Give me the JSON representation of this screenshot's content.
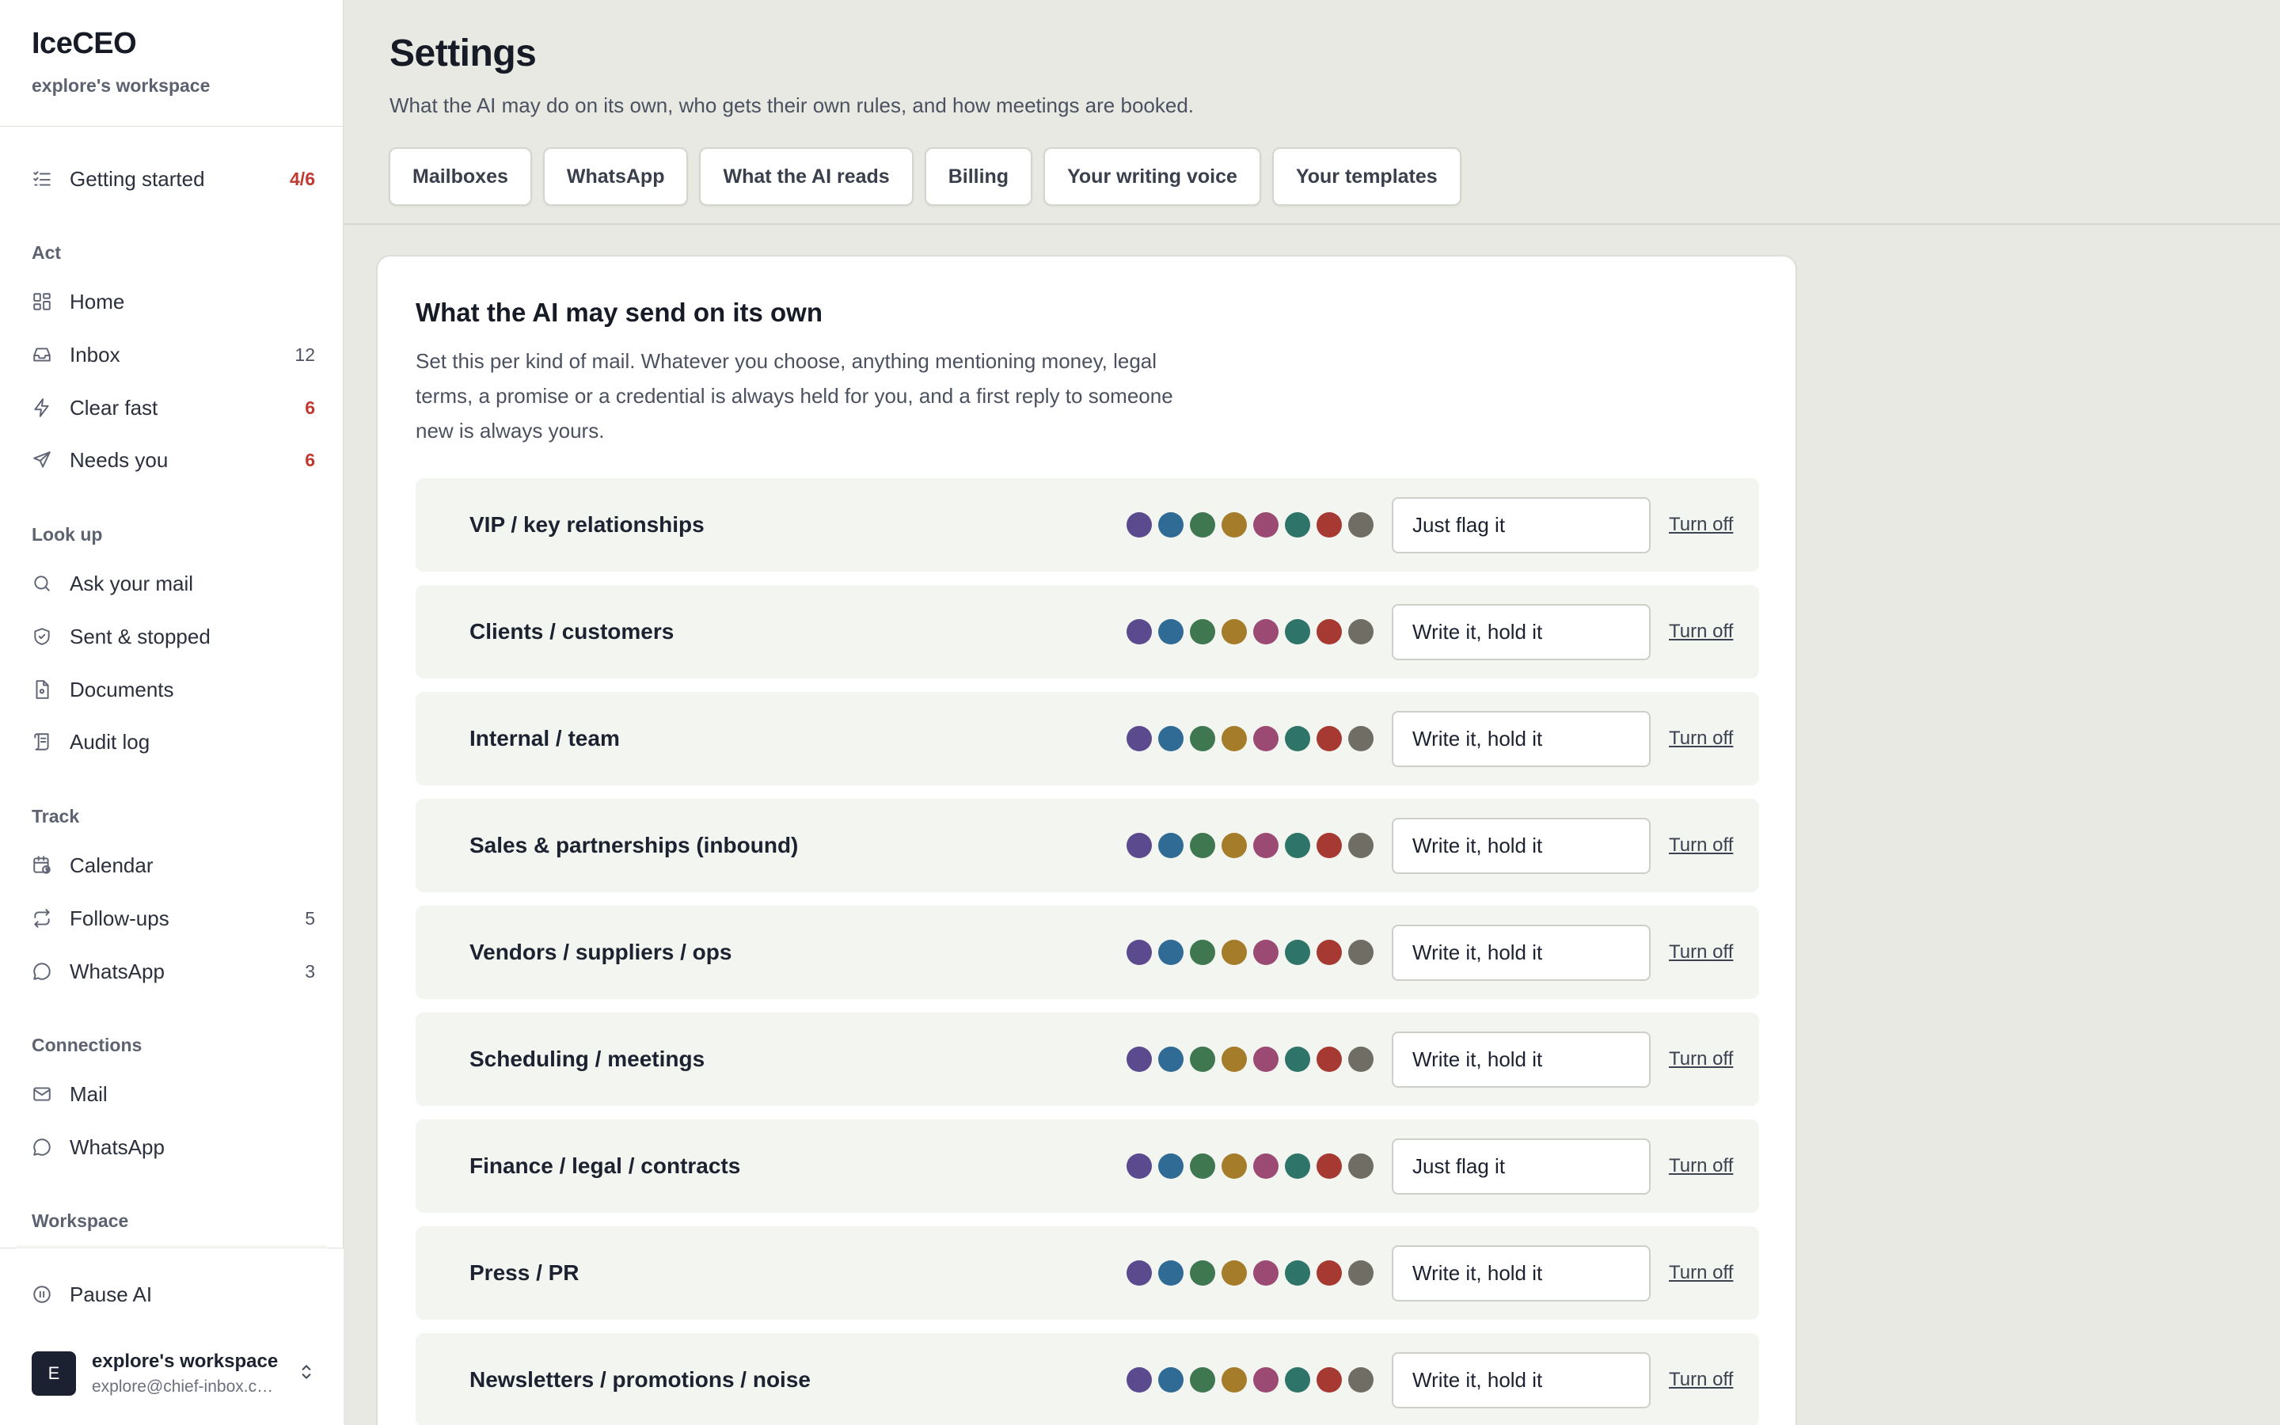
{
  "brand": {
    "name": "IceCEO",
    "workspace": "explore's workspace"
  },
  "sidebar": {
    "getting_started": {
      "label": "Getting started",
      "count": "4/6"
    },
    "sections": {
      "act": "Act",
      "lookup": "Look up",
      "track": "Track",
      "connections": "Connections",
      "workspace": "Workspace"
    },
    "act": [
      {
        "label": "Home",
        "count": "",
        "icon": "dashboard-icon"
      },
      {
        "label": "Inbox",
        "count": "12",
        "icon": "inbox-icon"
      },
      {
        "label": "Clear fast",
        "count": "6",
        "icon": "lightning-icon"
      },
      {
        "label": "Needs you",
        "count": "6",
        "icon": "send-icon"
      }
    ],
    "lookup": [
      {
        "label": "Ask your mail",
        "icon": "search-icon"
      },
      {
        "label": "Sent & stopped",
        "icon": "shield-icon"
      },
      {
        "label": "Documents",
        "icon": "document-icon"
      },
      {
        "label": "Audit log",
        "icon": "scroll-icon"
      }
    ],
    "track": [
      {
        "label": "Calendar",
        "count": "",
        "icon": "calendar-clock-icon"
      },
      {
        "label": "Follow-ups",
        "count": "5",
        "icon": "repeat-icon"
      },
      {
        "label": "WhatsApp",
        "count": "3",
        "icon": "chat-bubble-icon"
      }
    ],
    "connections": [
      {
        "label": "Mail",
        "icon": "mail-icon"
      },
      {
        "label": "WhatsApp",
        "icon": "chat-bubble-icon"
      }
    ],
    "pause": {
      "label": "Pause AI",
      "icon": "pause-icon"
    },
    "account": {
      "initial": "E",
      "name": "explore's workspace",
      "email": "explore@chief-inbox.com"
    }
  },
  "page": {
    "title": "Settings",
    "subtitle": "What the AI may do on its own, who gets their own rules, and how meetings are booked.",
    "tabs": [
      "Mailboxes",
      "WhatsApp",
      "What the AI reads",
      "Billing",
      "Your writing voice",
      "Your templates"
    ]
  },
  "card": {
    "title": "What the AI may send on its own",
    "description": "Set this per kind of mail. Whatever you choose, anything mentioning money, legal terms, a promise or a credential is always held for you, and a first reply to someone new is always yours.",
    "dot_colors": [
      "#5b4a8e",
      "#2f6b94",
      "#3f7750",
      "#a47c2a",
      "#9a4a73",
      "#2f7468",
      "#a63a33",
      "#6f6d64"
    ],
    "turn_off_label": "Turn off",
    "rows": [
      {
        "label": "VIP / key relationships",
        "mode": "Just flag it"
      },
      {
        "label": "Clients / customers",
        "mode": "Write it, hold it"
      },
      {
        "label": "Internal / team",
        "mode": "Write it, hold it"
      },
      {
        "label": "Sales & partnerships (inbound)",
        "mode": "Write it, hold it"
      },
      {
        "label": "Vendors / suppliers / ops",
        "mode": "Write it, hold it"
      },
      {
        "label": "Scheduling / meetings",
        "mode": "Write it, hold it"
      },
      {
        "label": "Finance / legal / contracts",
        "mode": "Just flag it"
      },
      {
        "label": "Press / PR",
        "mode": "Write it, hold it"
      },
      {
        "label": "Newsletters / promotions / noise",
        "mode": "Write it, hold it"
      }
    ]
  },
  "colors": {
    "accent_red": "#c1392f",
    "background": "#e7e9e2"
  }
}
